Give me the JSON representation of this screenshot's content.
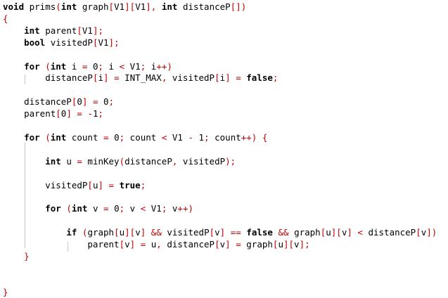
{
  "code_lines": [
    [
      [
        "kw",
        "void"
      ],
      [
        "pl",
        " prims"
      ],
      [
        "op",
        "("
      ],
      [
        "kw",
        "int"
      ],
      [
        "pl",
        " graph"
      ],
      [
        "op",
        "["
      ],
      [
        "pl",
        "V1"
      ],
      [
        "op",
        "]["
      ],
      [
        "pl",
        "V1"
      ],
      [
        "op",
        "],"
      ],
      [
        "pl",
        " "
      ],
      [
        "kw",
        "int"
      ],
      [
        "pl",
        " distanceP"
      ],
      [
        "op",
        "[])"
      ]
    ],
    [
      [
        "op",
        "{"
      ]
    ],
    [
      [
        "pl",
        "    "
      ],
      [
        "kw",
        "int"
      ],
      [
        "pl",
        " parent"
      ],
      [
        "op",
        "["
      ],
      [
        "pl",
        "V1"
      ],
      [
        "op",
        "];"
      ]
    ],
    [
      [
        "pl",
        "    "
      ],
      [
        "kw",
        "bool"
      ],
      [
        "pl",
        " visitedP"
      ],
      [
        "op",
        "["
      ],
      [
        "pl",
        "V1"
      ],
      [
        "op",
        "];"
      ]
    ],
    [],
    [
      [
        "pl",
        "    "
      ],
      [
        "kw",
        "for"
      ],
      [
        "pl",
        " "
      ],
      [
        "op",
        "("
      ],
      [
        "kw",
        "int"
      ],
      [
        "pl",
        " i "
      ],
      [
        "op",
        "="
      ],
      [
        "pl",
        " 0"
      ],
      [
        "op",
        ";"
      ],
      [
        "pl",
        " i "
      ],
      [
        "op",
        "<"
      ],
      [
        "pl",
        " V1"
      ],
      [
        "op",
        ";"
      ],
      [
        "pl",
        " i"
      ],
      [
        "op",
        "++)"
      ]
    ],
    [
      [
        "pl",
        "        distanceP"
      ],
      [
        "op",
        "["
      ],
      [
        "pl",
        "i"
      ],
      [
        "op",
        "]"
      ],
      [
        "pl",
        " "
      ],
      [
        "op",
        "="
      ],
      [
        "pl",
        " INT_MAX"
      ],
      [
        "op",
        ","
      ],
      [
        "pl",
        " visitedP"
      ],
      [
        "op",
        "["
      ],
      [
        "pl",
        "i"
      ],
      [
        "op",
        "]"
      ],
      [
        "pl",
        " "
      ],
      [
        "op",
        "="
      ],
      [
        "pl",
        " "
      ],
      [
        "kw",
        "false"
      ],
      [
        "op",
        ";"
      ]
    ],
    [],
    [
      [
        "pl",
        "    distanceP"
      ],
      [
        "op",
        "["
      ],
      [
        "pl",
        "0"
      ],
      [
        "op",
        "]"
      ],
      [
        "pl",
        " "
      ],
      [
        "op",
        "="
      ],
      [
        "pl",
        " 0"
      ],
      [
        "op",
        ";"
      ]
    ],
    [
      [
        "pl",
        "    parent"
      ],
      [
        "op",
        "["
      ],
      [
        "pl",
        "0"
      ],
      [
        "op",
        "]"
      ],
      [
        "pl",
        " "
      ],
      [
        "op",
        "="
      ],
      [
        "pl",
        " "
      ],
      [
        "op",
        "-"
      ],
      [
        "pl",
        "1"
      ],
      [
        "op",
        ";"
      ]
    ],
    [],
    [
      [
        "pl",
        "    "
      ],
      [
        "kw",
        "for"
      ],
      [
        "pl",
        " "
      ],
      [
        "op",
        "("
      ],
      [
        "kw",
        "int"
      ],
      [
        "pl",
        " count "
      ],
      [
        "op",
        "="
      ],
      [
        "pl",
        " 0"
      ],
      [
        "op",
        ";"
      ],
      [
        "pl",
        " count "
      ],
      [
        "op",
        "<"
      ],
      [
        "pl",
        " V1 "
      ],
      [
        "op",
        "-"
      ],
      [
        "pl",
        " 1"
      ],
      [
        "op",
        ";"
      ],
      [
        "pl",
        " count"
      ],
      [
        "op",
        "++)"
      ],
      [
        "pl",
        " "
      ],
      [
        "op",
        "{"
      ]
    ],
    [],
    [
      [
        "pl",
        "        "
      ],
      [
        "kw",
        "int"
      ],
      [
        "pl",
        " u "
      ],
      [
        "op",
        "="
      ],
      [
        "pl",
        " minKey"
      ],
      [
        "op",
        "("
      ],
      [
        "pl",
        "distanceP"
      ],
      [
        "op",
        ","
      ],
      [
        "pl",
        " visitedP"
      ],
      [
        "op",
        ");"
      ]
    ],
    [],
    [
      [
        "pl",
        "        visitedP"
      ],
      [
        "op",
        "["
      ],
      [
        "pl",
        "u"
      ],
      [
        "op",
        "]"
      ],
      [
        "pl",
        " "
      ],
      [
        "op",
        "="
      ],
      [
        "pl",
        " "
      ],
      [
        "kw",
        "true"
      ],
      [
        "op",
        ";"
      ]
    ],
    [],
    [
      [
        "pl",
        "        "
      ],
      [
        "kw",
        "for"
      ],
      [
        "pl",
        " "
      ],
      [
        "op",
        "("
      ],
      [
        "kw",
        "int"
      ],
      [
        "pl",
        " v "
      ],
      [
        "op",
        "="
      ],
      [
        "pl",
        " 0"
      ],
      [
        "op",
        ";"
      ],
      [
        "pl",
        " v "
      ],
      [
        "op",
        "<"
      ],
      [
        "pl",
        " V1"
      ],
      [
        "op",
        ";"
      ],
      [
        "pl",
        " v"
      ],
      [
        "op",
        "++)"
      ]
    ],
    [],
    [
      [
        "pl",
        "            "
      ],
      [
        "kw",
        "if"
      ],
      [
        "pl",
        " "
      ],
      [
        "op",
        "("
      ],
      [
        "pl",
        "graph"
      ],
      [
        "op",
        "["
      ],
      [
        "pl",
        "u"
      ],
      [
        "op",
        "]["
      ],
      [
        "pl",
        "v"
      ],
      [
        "op",
        "]"
      ],
      [
        "pl",
        " "
      ],
      [
        "op",
        "&&"
      ],
      [
        "pl",
        " visitedP"
      ],
      [
        "op",
        "["
      ],
      [
        "pl",
        "v"
      ],
      [
        "op",
        "]"
      ],
      [
        "pl",
        " "
      ],
      [
        "op",
        "=="
      ],
      [
        "pl",
        " "
      ],
      [
        "kw",
        "false"
      ],
      [
        "pl",
        " "
      ],
      [
        "op",
        "&&"
      ],
      [
        "pl",
        " graph"
      ],
      [
        "op",
        "["
      ],
      [
        "pl",
        "u"
      ],
      [
        "op",
        "]["
      ],
      [
        "pl",
        "v"
      ],
      [
        "op",
        "]"
      ],
      [
        "pl",
        " "
      ],
      [
        "op",
        "<"
      ],
      [
        "pl",
        " distanceP"
      ],
      [
        "op",
        "["
      ],
      [
        "pl",
        "v"
      ],
      [
        "op",
        "])"
      ]
    ],
    [
      [
        "pl",
        "                parent"
      ],
      [
        "op",
        "["
      ],
      [
        "pl",
        "v"
      ],
      [
        "op",
        "]"
      ],
      [
        "pl",
        " "
      ],
      [
        "op",
        "="
      ],
      [
        "pl",
        " u"
      ],
      [
        "op",
        ","
      ],
      [
        "pl",
        " distanceP"
      ],
      [
        "op",
        "["
      ],
      [
        "pl",
        "v"
      ],
      [
        "op",
        "]"
      ],
      [
        "pl",
        " "
      ],
      [
        "op",
        "="
      ],
      [
        "pl",
        " graph"
      ],
      [
        "op",
        "["
      ],
      [
        "pl",
        "u"
      ],
      [
        "op",
        "]["
      ],
      [
        "pl",
        "v"
      ],
      [
        "op",
        "];"
      ]
    ],
    [
      [
        "pl",
        "    "
      ],
      [
        "op",
        "}"
      ]
    ],
    [],
    [],
    [
      [
        "op",
        "}"
      ]
    ]
  ]
}
